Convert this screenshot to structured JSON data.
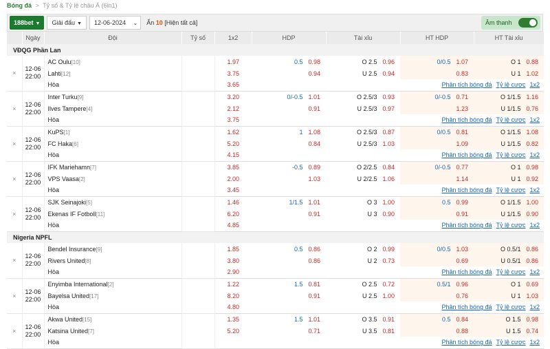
{
  "breadcrumb": {
    "home": "Bóng đá",
    "sep": ">",
    "current": "Tỷ số & Tỷ lệ châu Á",
    "suffix": "(6in1)"
  },
  "toolbar": {
    "bookmaker": "188bet",
    "league_filter": "Giải đấu",
    "date": "12-06-2024",
    "hidden_label": "Ẩn",
    "hidden_count": "10",
    "show_all": "[Hiện tất cả]",
    "sound_label": "Âm thanh"
  },
  "headers": [
    "",
    "Ngày",
    "Đội",
    "Tỷ số",
    "1x2",
    "HDP",
    "Tài xỉu",
    "HT HDP",
    "HT Tài xỉu"
  ],
  "links": {
    "analysis": "Phân tích bóng đá",
    "odds": "Tỷ lệ cược",
    "x12": "1x2"
  },
  "draw_label": "Hòa",
  "leagues": [
    {
      "name": "VĐQG Phần Lan",
      "matches": [
        {
          "date": "12-06",
          "time": "22:00",
          "home": "AC Oulu",
          "hr": "[10]",
          "away": "Lahti",
          "ar": "[12]",
          "o1": "1.97",
          "o2": "3.75",
          "ox": "3.65",
          "hdp_l": "0.5",
          "hdp_h": "0.98",
          "hdp_a": "0.94",
          "tx_l": "O 2.5",
          "tx_h": "0.96",
          "tx_ul": "U 2.5",
          "tx_a": "0.94",
          "hth_l": "0/0.5",
          "hth_h": "1.07",
          "hth_a": "0.83",
          "htt_l": "O 1",
          "htt_h": "0.88",
          "htt_ul": "U 1",
          "htt_a": "1.02"
        },
        {
          "date": "12-06",
          "time": "22:00",
          "home": "Inter Turku",
          "hr": "[9]",
          "away": "Ilves Tampere",
          "ar": "[4]",
          "o1": "3.20",
          "o2": "2.12",
          "ox": "3.75",
          "hdp_l": "0/-0.5",
          "hdp_h": "1.01",
          "hdp_a": "0.91",
          "tx_l": "O 2.5/3",
          "tx_h": "0.93",
          "tx_ul": "U 2.5/3",
          "tx_a": "0.97",
          "hth_l": "0/-0.5",
          "hth_h": "0.71",
          "hth_a": "1.23",
          "htt_l": "O 1/1.5",
          "htt_h": "1.16",
          "htt_ul": "U 1/1.5",
          "htt_a": "0.76"
        },
        {
          "date": "12-06",
          "time": "22:00",
          "home": "KuPS",
          "hr": "[1]",
          "away": "FC Haka",
          "ar": "[6]",
          "o1": "1.62",
          "o2": "5.20",
          "ox": "4.15",
          "hdp_l": "1",
          "hdp_h": "1.08",
          "hdp_a": "0.84",
          "tx_l": "O 2.5/3",
          "tx_h": "0.87",
          "tx_ul": "U 2.5/3",
          "tx_a": "1.03",
          "hth_l": "0/0.5",
          "hth_h": "0.81",
          "hth_a": "1.09",
          "htt_l": "O 1/1.5",
          "htt_h": "1.08",
          "htt_ul": "U 1/1.5",
          "htt_a": "0.82"
        },
        {
          "date": "12-06",
          "time": "22:00",
          "home": "IFK Mariehamn",
          "hr": "[7]",
          "away": "VPS Vaasa",
          "ar": "[2]",
          "o1": "3.85",
          "o2": "2.00",
          "ox": "3.45",
          "hdp_l": "-0.5",
          "hdp_h": "0.89",
          "hdp_a": "1.03",
          "tx_l": "O 2/2.5",
          "tx_h": "0.84",
          "tx_ul": "U 2/2.5",
          "tx_a": "1.06",
          "hth_l": "0/-0.5",
          "hth_h": "0.77",
          "hth_a": "1.14",
          "htt_l": "O 1",
          "htt_h": "0.98",
          "htt_ul": "U 1",
          "htt_a": "0.92"
        },
        {
          "date": "12-06",
          "time": "22:00",
          "home": "SJK Seinajoki",
          "hr": "[5]",
          "away": "Ekenas IF Fotboll",
          "ar": "[11]",
          "o1": "1.46",
          "o2": "6.20",
          "ox": "4.85",
          "hdp_l": "1/1.5",
          "hdp_h": "1.01",
          "hdp_a": "0.91",
          "tx_l": "O 3",
          "tx_h": "1.00",
          "tx_ul": "U 3",
          "tx_a": "0.90",
          "hth_l": "0.5",
          "hth_h": "0.99",
          "hth_a": "0.91",
          "htt_l": "O 1/1.5",
          "htt_h": "1.00",
          "htt_ul": "U 1/1.5",
          "htt_a": "0.90"
        }
      ]
    },
    {
      "name": "Nigeria NPFL",
      "matches": [
        {
          "date": "12-06",
          "time": "22:00",
          "home": "Bendel Insurance",
          "hr": "[9]",
          "away": "Rivers United",
          "ar": "[8]",
          "o1": "1.85",
          "o2": "3.80",
          "ox": "2.90",
          "hdp_l": "0.5",
          "hdp_h": "0.86",
          "hdp_a": "0.86",
          "tx_l": "O 2",
          "tx_h": "0.99",
          "tx_ul": "U 2",
          "tx_a": "0.73",
          "hth_l": "0/0.5",
          "hth_h": "1.03",
          "hth_a": "0.69",
          "htt_l": "O 0.5/1",
          "htt_h": "0.86",
          "htt_ul": "U 0.5/1",
          "htt_a": "0.86"
        },
        {
          "date": "12-06",
          "time": "22:00",
          "home": "Enyimba International",
          "hr": "[2]",
          "away": "Bayelsa United",
          "ar": "[17]",
          "o1": "1.22",
          "o2": "8.20",
          "ox": "4.80",
          "hdp_l": "1.5",
          "hdp_h": "0.81",
          "hdp_a": "0.91",
          "tx_l": "O 2.5",
          "tx_h": "0.72",
          "tx_ul": "U 2.5",
          "tx_a": "1.00",
          "hth_l": "0.5/1",
          "hth_h": "0.96",
          "hth_a": "0.76",
          "htt_l": "O 1",
          "htt_h": "0.69",
          "htt_ul": "U 1",
          "htt_a": "1.03"
        },
        {
          "date": "12-06",
          "time": "22:00",
          "home": "Akwa United",
          "hr": "[15]",
          "away": "Katsina United",
          "ar": "[7]",
          "o1": "1.35",
          "o2": "5.20",
          "ox": "",
          "hdp_l": "1.5",
          "hdp_h": "1.01",
          "hdp_a": "0.71",
          "tx_l": "O 3.5",
          "tx_h": "0.91",
          "tx_ul": "U 3.5",
          "tx_a": "0.81",
          "hth_l": "0.5",
          "hth_h": "0.84",
          "hth_a": "0.88",
          "htt_l": "O 1.5",
          "htt_h": "0.98",
          "htt_ul": "U 1.5",
          "htt_a": "0.74"
        }
      ]
    }
  ]
}
